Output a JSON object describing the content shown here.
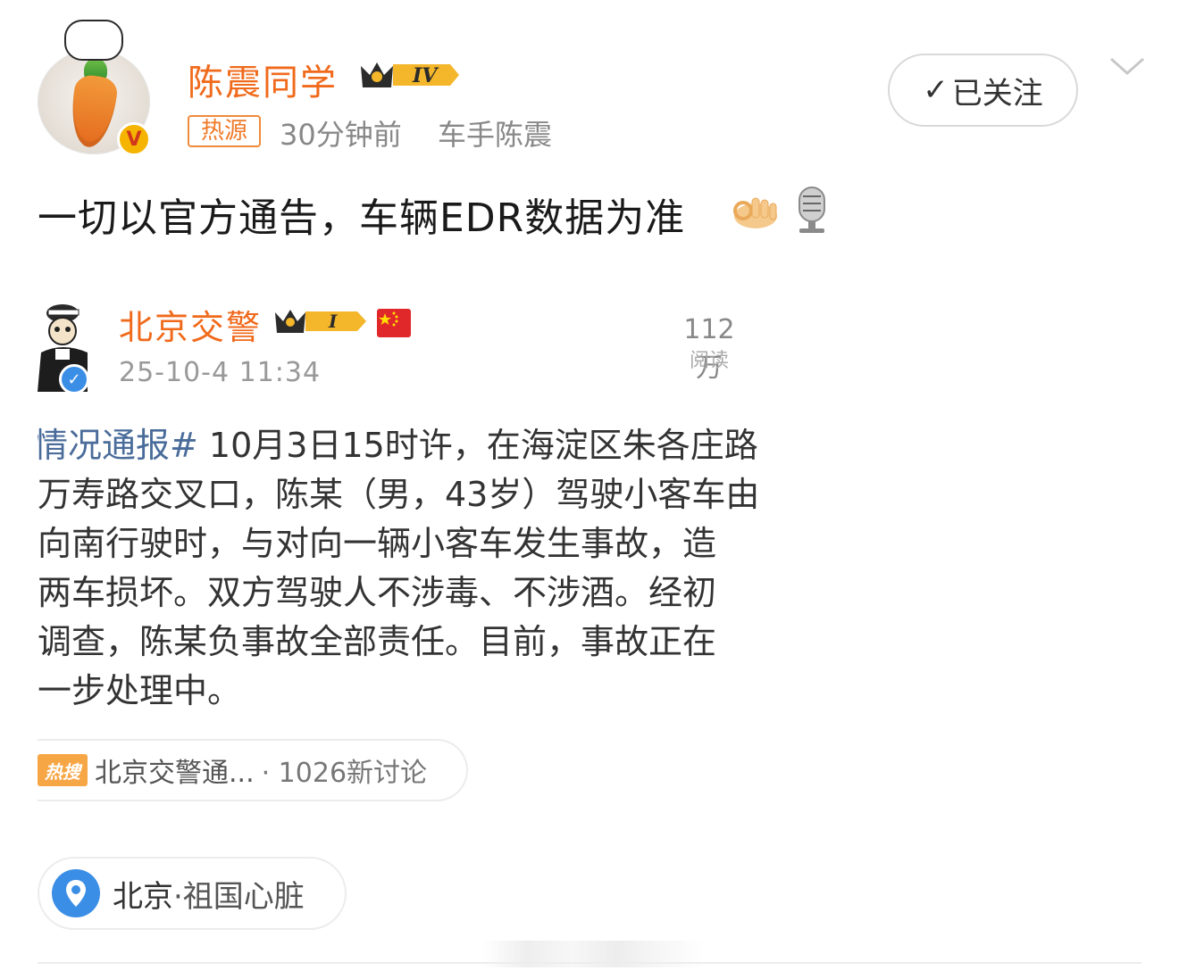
{
  "header": {
    "username": "陈震同学",
    "level_badge": "IV",
    "hot_tag": "热源",
    "time": "30分钟前",
    "source": "车手陈震",
    "follow_label": "已关注"
  },
  "post": {
    "text": "一切以官方通告，车辆EDR数据为准",
    "emoji_1": "ok-hand-icon",
    "emoji_2": "microphone-icon"
  },
  "embedded": {
    "name": "北京交警",
    "level_badge": "I",
    "date": "25-10-4 11:34",
    "read_count": "112万",
    "read_label": "阅读",
    "lines": [
      {
        "hashtag": "情况通报#",
        "text": " 10月3日15时许，在海淀区朱各庄路"
      },
      {
        "hashtag": "",
        "text": "万寿路交叉口，陈某（男，43岁）驾驶小客车由"
      },
      {
        "hashtag": "",
        "text": "向南行驶时，与对向一辆小客车发生事故，造"
      },
      {
        "hashtag": "",
        "text": "两车损坏。双方驾驶人不涉毒、不涉酒。经初"
      },
      {
        "hashtag": "",
        "text": "调查，陈某负事故全部责任。目前，事故正在"
      },
      {
        "hashtag": "",
        "text": "一步处理中。"
      }
    ],
    "hot_search_icon": "热搜",
    "hot_search_text": "北京交警通...",
    "hot_search_count": "· 1026新讨论"
  },
  "location": {
    "city": "北京",
    "place": "·祖国心脏"
  },
  "colors": {
    "accent_orange": "#f06a1c",
    "hashtag_blue": "#4a6c9a",
    "location_blue": "#3b8ee6"
  }
}
